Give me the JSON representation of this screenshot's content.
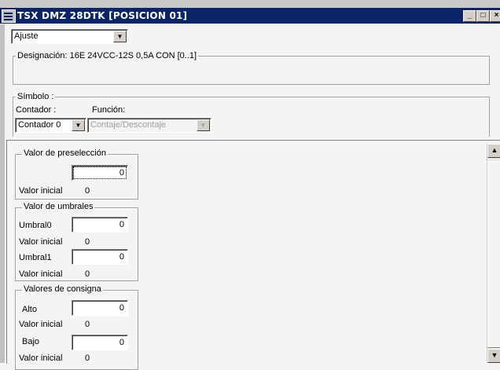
{
  "window": {
    "title": "TSX DMZ 28DTK [POSICION 01]",
    "minimize_glyph": "_",
    "maximize_glyph": "□",
    "close_glyph": "×",
    "title_bg": "#0a246a"
  },
  "mode_select": {
    "value": "Ajuste"
  },
  "designation": {
    "label": "Designación: 16E 24VCC-12S 0,5A CON [0..1]"
  },
  "symbol": {
    "label": "Símbolo :",
    "counter_label": "Contador :",
    "function_label": "Función:",
    "counter_value": "Contador 0",
    "function_value": "Contaje/Descontaje"
  },
  "preselection": {
    "title": "Valor de preselección",
    "value": "0",
    "initial_label": "Valor inicial",
    "initial_value": "0"
  },
  "thresholds": {
    "title": "Valor de umbrales",
    "threshold0_label": "Umbral0",
    "threshold0_value": "0",
    "threshold0_initial_label": "Valor inicial",
    "threshold0_initial_value": "0",
    "threshold1_label": "Umbral1",
    "threshold1_value": "0",
    "threshold1_initial_label": "Valor inicial",
    "threshold1_initial_value": "0"
  },
  "setpoints": {
    "title": "Valores de consigna",
    "high_label": "Alto",
    "high_value": "0",
    "high_initial_label": "Valor inicial",
    "high_initial_value": "0",
    "low_label": "Bajo",
    "low_value": "0",
    "low_initial_label": "Valor inicial",
    "low_initial_value": "0"
  },
  "scrollbar": {
    "up_glyph": "▲",
    "down_glyph": "▼"
  }
}
